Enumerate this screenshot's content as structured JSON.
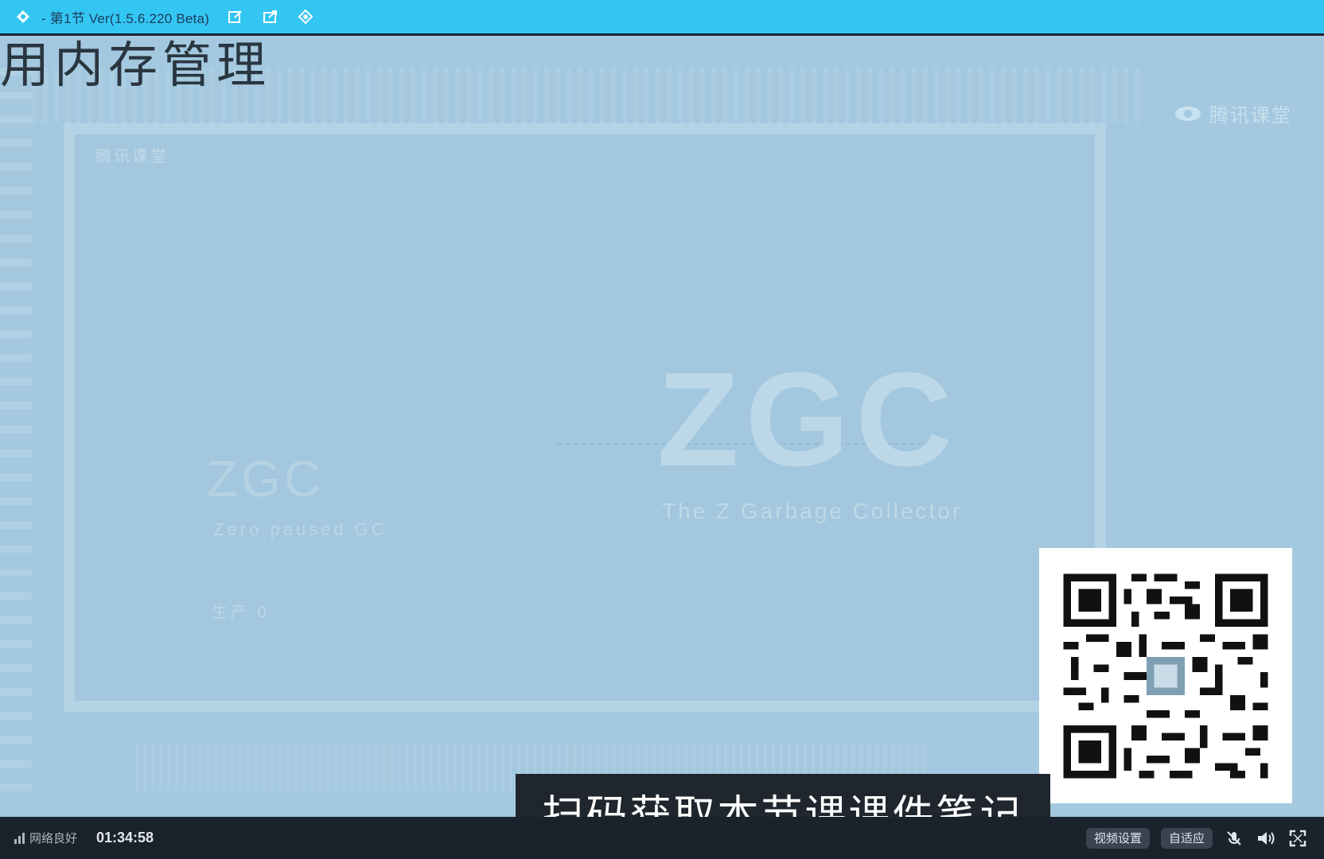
{
  "window": {
    "title": "- 第1节 Ver(1.5.6.220 Beta)"
  },
  "slide": {
    "heading": "用内存管理",
    "subheading": "腾讯课堂",
    "zgc_small": "ZGC",
    "zgc_small_sub": "Zero paused GC",
    "zgc_small_foot": "生产 0",
    "zgc_big": "ZGC",
    "zgc_big_sub": "The Z Garbage Collector",
    "brand": "腾讯课堂"
  },
  "qr": {
    "caption": "扫码获取本节课课件笔记"
  },
  "controls": {
    "network_status": "网络良好",
    "elapsed": "01:34:58",
    "video_settings_label": "视频设置",
    "adaptive_label": "自适应"
  },
  "colors": {
    "titlebar": "#33c6f3",
    "stage": "#a3c8df",
    "controlbar": "#1a222c"
  }
}
